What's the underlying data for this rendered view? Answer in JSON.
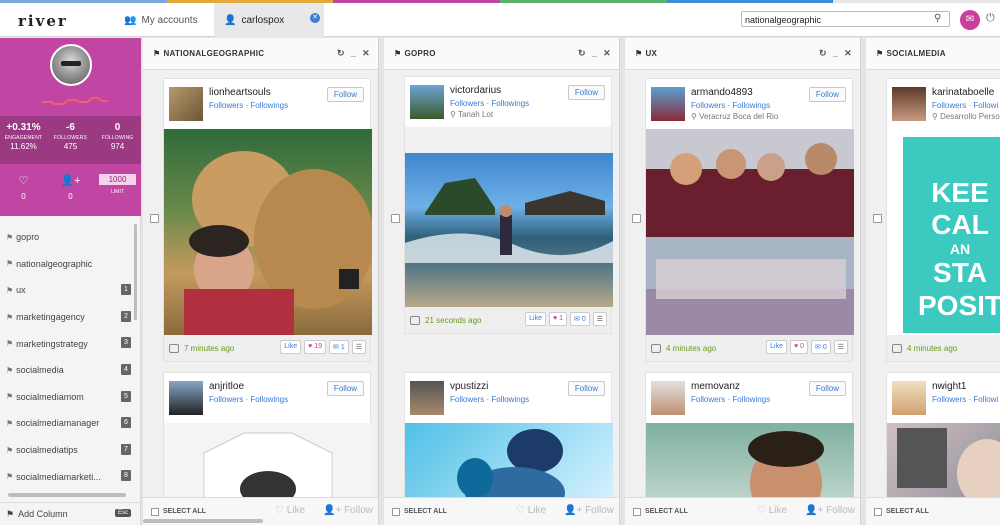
{
  "app": {
    "logo": "river"
  },
  "stripe_colors": [
    "#7aa8d8",
    "#e2a83c",
    "#c146a3",
    "#5bb36b",
    "#3a8fd5",
    "#e6e6e6"
  ],
  "tabs": [
    {
      "label": "My accounts",
      "icon": "people-icon"
    },
    {
      "label": "carlospox",
      "icon": "user-icon"
    }
  ],
  "search": {
    "value": "nationalgeographic"
  },
  "profile": {
    "stats": [
      {
        "value": "+0.31%",
        "label": "ENGAGEMENT",
        "sub": "11.62%"
      },
      {
        "value": "-6",
        "label": "FOLLOWERS",
        "sub": "475"
      },
      {
        "value": "0",
        "label": "FOLLOWING",
        "sub": "974"
      }
    ],
    "likes": "0",
    "follows": "0",
    "limit_value": "1000",
    "limit_label": "LIMIT"
  },
  "sidebar": {
    "tags": [
      {
        "label": "gopro",
        "badge": ""
      },
      {
        "label": "nationalgeographic",
        "badge": ""
      },
      {
        "label": "ux",
        "badge": "1"
      },
      {
        "label": "marketingagency",
        "badge": "2"
      },
      {
        "label": "marketingstrategy",
        "badge": "3"
      },
      {
        "label": "socialmedia",
        "badge": "4"
      },
      {
        "label": "socialmediamom",
        "badge": "5"
      },
      {
        "label": "socialmediamanager",
        "badge": "6"
      },
      {
        "label": "socialmediatips",
        "badge": "7"
      },
      {
        "label": "socialmediamarketi...",
        "badge": "8"
      }
    ],
    "add_column": "Add Column",
    "esc": "Esc"
  },
  "columns": [
    {
      "title": "NATIONALGEOGRAPHIC",
      "posts": [
        {
          "user": "lionheartsouls",
          "links": "Followers · Followings",
          "location": "",
          "follow": "Follow",
          "time": "7 minutes ago",
          "like": "Like",
          "hearts": "19",
          "comments": "1"
        },
        {
          "user": "anjritloe",
          "links": "Followers · Followings",
          "location": "",
          "follow": "Follow"
        }
      ]
    },
    {
      "title": "GOPRO",
      "posts": [
        {
          "user": "victordarius",
          "links": "Followers · Followings",
          "location": "Tanah Lot",
          "follow": "Follow",
          "time": "21 seconds ago",
          "like": "Like",
          "hearts": "1",
          "comments": "0"
        },
        {
          "user": "vpustizzi",
          "links": "Followers · Followings",
          "location": "",
          "follow": "Follow"
        }
      ]
    },
    {
      "title": "UX",
      "posts": [
        {
          "user": "armando4893",
          "links": "Followers · Followings",
          "location": "Veracruz Boca del Rio",
          "follow": "Follow",
          "time": "4 minutes ago",
          "like": "Like",
          "hearts": "0",
          "comments": "0"
        },
        {
          "user": "memovanz",
          "links": "Followers · Followings",
          "location": "",
          "follow": "Follow"
        }
      ]
    },
    {
      "title": "SOCIALMEDIA",
      "posts": [
        {
          "user": "karinataboelle",
          "links": "Followers · Followi",
          "location": "Desarrollo Persona",
          "follow": "",
          "time": "4 minutes ago",
          "like": "",
          "hearts": "",
          "comments": "",
          "sign_lines": [
            "KEE",
            "CAL",
            "AN",
            "STA",
            "POSIT"
          ]
        },
        {
          "user": "nwight1",
          "links": "Followers · Followi",
          "location": "",
          "follow": ""
        }
      ]
    }
  ],
  "column_footer": {
    "select_all": "SELECT ALL",
    "like": "Like",
    "follow": "Follow"
  }
}
